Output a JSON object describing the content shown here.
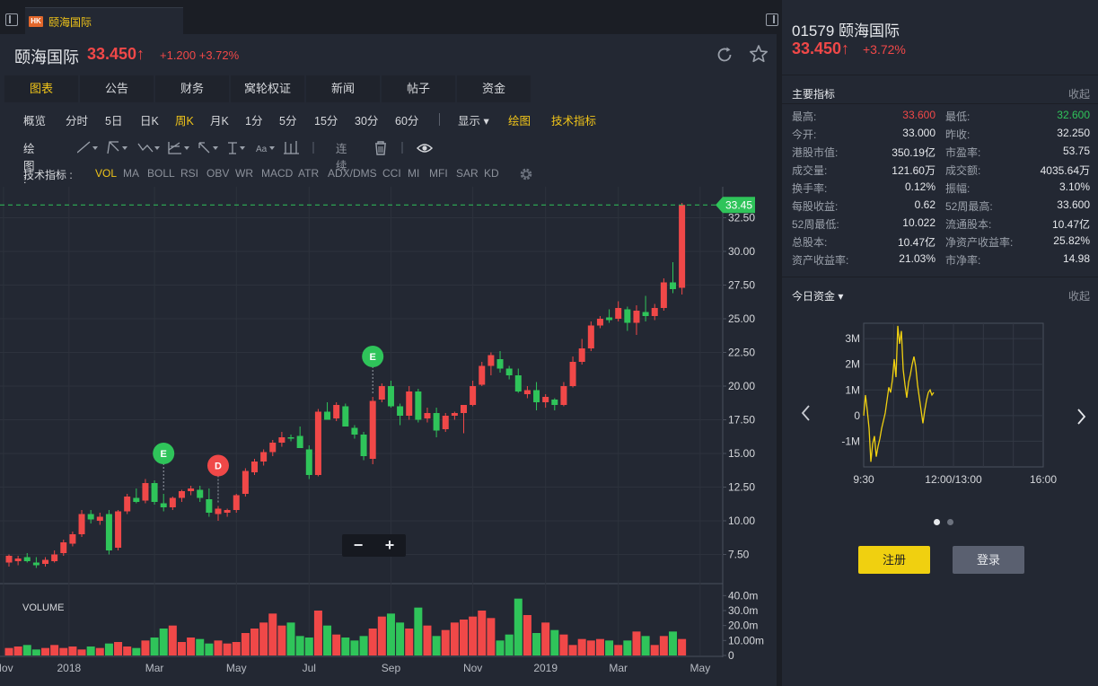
{
  "tab": {
    "market": "HK",
    "label": "颐海国际"
  },
  "header": {
    "name": "颐海国际",
    "price": "33.450↑",
    "change": "+1.200 +3.72%"
  },
  "main_tabs": [
    "图表",
    "公告",
    "财务",
    "窝轮权证",
    "新闻",
    "帖子",
    "资金"
  ],
  "timeframes": [
    "概览",
    "分时",
    "5日",
    "日K",
    "周K",
    "月K",
    "1分",
    "5分",
    "15分",
    "30分",
    "60分"
  ],
  "active_timeframe": "周K",
  "chart_options": {
    "display": "显示",
    "draw": "绘图",
    "indicators": "技术指标"
  },
  "draw_toolbar": {
    "label": "绘图 :",
    "continuous": "连续"
  },
  "indicator_bar": {
    "label": "技术指标 :",
    "items": [
      "VOL",
      "MA",
      "BOLL",
      "RSI",
      "OBV",
      "WR",
      "MACD",
      "ATR",
      "ADX/DMS",
      "CCI",
      "MI",
      "MFI",
      "SAR",
      "KD"
    ],
    "active": "VOL"
  },
  "chart_data": {
    "type": "candlestick",
    "price_axis_ticks": [
      "32.50",
      "30.00",
      "27.50",
      "25.00",
      "22.50",
      "20.00",
      "17.50",
      "15.00",
      "12.50",
      "10.00",
      "7.50"
    ],
    "price_range": [
      5.4,
      34.4
    ],
    "last_price_tag": "33.45",
    "last_price": 33.45,
    "x_axis_labels": [
      "Nov",
      "2018",
      "Mar",
      "May",
      "Jul",
      "Sep",
      "Nov",
      "2019",
      "Mar",
      "May"
    ],
    "volume_label": "VOLUME",
    "volume_axis_ticks": [
      "40.0m",
      "30.0m",
      "20.0m",
      "10.00m",
      "0"
    ],
    "volume_range_m": [
      0,
      48
    ],
    "colors": {
      "up": "#f04848",
      "down": "#2fc45a"
    },
    "candles": [
      {
        "o": 6.9,
        "h": 7.5,
        "l": 6.6,
        "c": 7.4
      },
      {
        "o": 7.0,
        "h": 7.4,
        "l": 6.7,
        "c": 7.2
      },
      {
        "o": 7.3,
        "h": 7.6,
        "l": 6.9,
        "c": 7.0
      },
      {
        "o": 6.9,
        "h": 7.3,
        "l": 6.5,
        "c": 6.7
      },
      {
        "o": 6.8,
        "h": 7.3,
        "l": 6.6,
        "c": 7.1
      },
      {
        "o": 7.0,
        "h": 7.8,
        "l": 6.9,
        "c": 7.5
      },
      {
        "o": 7.6,
        "h": 8.6,
        "l": 7.4,
        "c": 8.4
      },
      {
        "o": 8.3,
        "h": 9.2,
        "l": 8.1,
        "c": 9.0
      },
      {
        "o": 9.0,
        "h": 10.8,
        "l": 8.8,
        "c": 10.5
      },
      {
        "o": 10.5,
        "h": 10.8,
        "l": 9.8,
        "c": 10.1
      },
      {
        "o": 10.0,
        "h": 10.6,
        "l": 9.7,
        "c": 10.3
      },
      {
        "o": 10.5,
        "h": 10.8,
        "l": 7.5,
        "c": 7.8
      },
      {
        "o": 8.0,
        "h": 10.8,
        "l": 7.8,
        "c": 10.7
      },
      {
        "o": 10.7,
        "h": 12.0,
        "l": 10.5,
        "c": 11.8
      },
      {
        "o": 11.7,
        "h": 12.4,
        "l": 11.3,
        "c": 11.4
      },
      {
        "o": 11.5,
        "h": 13.1,
        "l": 11.3,
        "c": 12.8
      },
      {
        "o": 12.8,
        "h": 13.0,
        "l": 11.2,
        "c": 11.4
      },
      {
        "o": 11.3,
        "h": 12.0,
        "l": 10.7,
        "c": 11.0
      },
      {
        "o": 11.0,
        "h": 11.8,
        "l": 10.8,
        "c": 11.7
      },
      {
        "o": 11.7,
        "h": 12.3,
        "l": 11.4,
        "c": 12.2
      },
      {
        "o": 12.2,
        "h": 12.6,
        "l": 11.9,
        "c": 12.4
      },
      {
        "o": 12.3,
        "h": 12.6,
        "l": 11.4,
        "c": 11.7
      },
      {
        "o": 11.6,
        "h": 12.4,
        "l": 10.3,
        "c": 10.6
      },
      {
        "o": 10.5,
        "h": 11.1,
        "l": 10.0,
        "c": 10.9
      },
      {
        "o": 10.6,
        "h": 10.9,
        "l": 10.3,
        "c": 10.8
      },
      {
        "o": 10.8,
        "h": 12.0,
        "l": 10.6,
        "c": 11.9
      },
      {
        "o": 12.0,
        "h": 13.9,
        "l": 11.8,
        "c": 13.7
      },
      {
        "o": 13.6,
        "h": 14.6,
        "l": 13.4,
        "c": 14.4
      },
      {
        "o": 14.4,
        "h": 15.3,
        "l": 14.1,
        "c": 15.1
      },
      {
        "o": 15.1,
        "h": 16.0,
        "l": 14.8,
        "c": 15.8
      },
      {
        "o": 15.8,
        "h": 16.6,
        "l": 15.5,
        "c": 16.2
      },
      {
        "o": 16.2,
        "h": 16.4,
        "l": 15.9,
        "c": 16.1
      },
      {
        "o": 16.3,
        "h": 17.0,
        "l": 15.9,
        "c": 15.4
      },
      {
        "o": 15.3,
        "h": 15.6,
        "l": 13.1,
        "c": 13.4
      },
      {
        "o": 13.4,
        "h": 18.3,
        "l": 13.3,
        "c": 18.1
      },
      {
        "o": 18.1,
        "h": 18.8,
        "l": 17.6,
        "c": 17.5
      },
      {
        "o": 17.6,
        "h": 18.8,
        "l": 17.4,
        "c": 18.6
      },
      {
        "o": 18.5,
        "h": 18.7,
        "l": 17.2,
        "c": 17.0
      },
      {
        "o": 16.9,
        "h": 17.1,
        "l": 16.1,
        "c": 16.4
      },
      {
        "o": 16.4,
        "h": 16.6,
        "l": 14.5,
        "c": 14.8
      },
      {
        "o": 14.6,
        "h": 19.2,
        "l": 14.2,
        "c": 18.9
      },
      {
        "o": 19.0,
        "h": 20.2,
        "l": 18.8,
        "c": 20.0
      },
      {
        "o": 20.0,
        "h": 20.4,
        "l": 18.4,
        "c": 18.5
      },
      {
        "o": 18.5,
        "h": 18.7,
        "l": 17.1,
        "c": 17.8
      },
      {
        "o": 17.8,
        "h": 20.0,
        "l": 17.5,
        "c": 19.6
      },
      {
        "o": 19.6,
        "h": 19.8,
        "l": 17.3,
        "c": 17.5
      },
      {
        "o": 17.6,
        "h": 18.4,
        "l": 17.3,
        "c": 18.0
      },
      {
        "o": 18.0,
        "h": 18.4,
        "l": 16.2,
        "c": 16.7
      },
      {
        "o": 16.8,
        "h": 18.0,
        "l": 16.6,
        "c": 17.8
      },
      {
        "o": 17.8,
        "h": 18.1,
        "l": 17.5,
        "c": 18.0
      },
      {
        "o": 18.0,
        "h": 18.6,
        "l": 16.5,
        "c": 18.6
      },
      {
        "o": 18.6,
        "h": 20.4,
        "l": 18.5,
        "c": 20.0
      },
      {
        "o": 20.1,
        "h": 21.8,
        "l": 20.0,
        "c": 21.5
      },
      {
        "o": 21.5,
        "h": 22.5,
        "l": 20.8,
        "c": 22.3
      },
      {
        "o": 22.0,
        "h": 22.6,
        "l": 21.0,
        "c": 21.3
      },
      {
        "o": 21.3,
        "h": 21.5,
        "l": 20.5,
        "c": 20.8
      },
      {
        "o": 20.8,
        "h": 21.3,
        "l": 19.5,
        "c": 19.6
      },
      {
        "o": 19.4,
        "h": 20.0,
        "l": 19.1,
        "c": 19.7
      },
      {
        "o": 19.7,
        "h": 20.3,
        "l": 18.2,
        "c": 18.8
      },
      {
        "o": 18.8,
        "h": 19.4,
        "l": 18.4,
        "c": 19.2
      },
      {
        "o": 19.0,
        "h": 19.1,
        "l": 18.2,
        "c": 18.6
      },
      {
        "o": 18.6,
        "h": 20.3,
        "l": 18.5,
        "c": 20.0
      },
      {
        "o": 20.0,
        "h": 22.2,
        "l": 19.9,
        "c": 21.8
      },
      {
        "o": 21.8,
        "h": 23.5,
        "l": 21.6,
        "c": 22.8
      },
      {
        "o": 22.8,
        "h": 24.8,
        "l": 22.6,
        "c": 24.5
      },
      {
        "o": 24.5,
        "h": 25.2,
        "l": 24.3,
        "c": 25.0
      },
      {
        "o": 25.1,
        "h": 25.7,
        "l": 24.7,
        "c": 24.9
      },
      {
        "o": 25.0,
        "h": 26.3,
        "l": 24.8,
        "c": 25.8
      },
      {
        "o": 25.7,
        "h": 25.9,
        "l": 24.1,
        "c": 24.7
      },
      {
        "o": 24.7,
        "h": 26.0,
        "l": 23.8,
        "c": 25.6
      },
      {
        "o": 25.5,
        "h": 26.7,
        "l": 24.8,
        "c": 25.2
      },
      {
        "o": 25.2,
        "h": 26.1,
        "l": 24.9,
        "c": 25.8
      },
      {
        "o": 25.8,
        "h": 28.0,
        "l": 25.6,
        "c": 27.7
      },
      {
        "o": 27.7,
        "h": 29.2,
        "l": 26.9,
        "c": 27.2
      },
      {
        "o": 27.3,
        "h": 33.6,
        "l": 26.8,
        "c": 33.45
      }
    ],
    "volumes_m": [
      5,
      6,
      7,
      4,
      5,
      7,
      5,
      6,
      4,
      6,
      5,
      8,
      9,
      6,
      5,
      10,
      12,
      18,
      20,
      9,
      12,
      11,
      8,
      10,
      8,
      9,
      15,
      18,
      22,
      28,
      20,
      22,
      13,
      12,
      30,
      20,
      14,
      12,
      10,
      13,
      18,
      26,
      28,
      22,
      18,
      32,
      20,
      13,
      17,
      22,
      24,
      26,
      30,
      25,
      10,
      14,
      38,
      27,
      15,
      22,
      17,
      14,
      7,
      11,
      10,
      11,
      10,
      7,
      10,
      16,
      13,
      7,
      13,
      16,
      11,
      7,
      8,
      9
    ],
    "event_markers": [
      {
        "label": "E",
        "candle": 17,
        "kind": "earnings"
      },
      {
        "label": "D",
        "candle": 23,
        "kind": "dividend"
      },
      {
        "label": "E",
        "candle": 40,
        "kind": "earnings"
      }
    ],
    "grid": true
  },
  "zoom": {
    "minus": "−",
    "plus": "+"
  },
  "side": {
    "code_name": "01579 颐海国际",
    "price": "33.450↑",
    "change": "+3.72%",
    "metrics_title": "主要指标",
    "collapse": "收起",
    "metrics": [
      [
        "最高:",
        "33.600",
        "最低:",
        "32.600"
      ],
      [
        "今开:",
        "33.000",
        "昨收:",
        "32.250"
      ],
      [
        "港股市值:",
        "350.19亿",
        "市盈率:",
        "53.75"
      ],
      [
        "成交量:",
        "121.60万",
        "成交额:",
        "4035.64万"
      ],
      [
        "换手率:",
        "0.12%",
        "振幅:",
        "3.10%"
      ],
      [
        "每股收益:",
        "0.62",
        "52周最高:",
        "33.600"
      ],
      [
        "52周最低:",
        "10.022",
        "流通股本:",
        "10.47亿"
      ],
      [
        "总股本:",
        "10.47亿",
        "净资产收益率:",
        "25.82%"
      ],
      [
        "资产收益率:",
        "21.03%",
        "市净率:",
        "14.98"
      ]
    ],
    "metric_colors": {
      "high": "#f04848",
      "low": "#2fc45a"
    },
    "funds_title": "今日资金",
    "funds_collapse": "收起",
    "funds_chart": {
      "y_ticks": [
        "3M",
        "2M",
        "1M",
        "0",
        "-1M"
      ],
      "x_ticks": [
        "9:30",
        "12:00/13:00",
        "16:00"
      ],
      "y_range_m": [
        -2,
        3.6
      ],
      "values_m": [
        0,
        0.8,
        0.2,
        -0.5,
        -1.8,
        -1.1,
        -0.8,
        -1.6,
        -1.2,
        -0.9,
        -0.5,
        -0.2,
        0.1,
        0.6,
        1.1,
        0.9,
        1.4,
        2.2,
        1.5,
        3.5,
        2.8,
        3.3,
        1.8,
        1.2,
        0.7,
        1.3,
        1.6,
        2.0,
        2.3,
        1.9,
        1.2,
        0.7,
        0.2,
        -0.3,
        0.2,
        0.6,
        0.9,
        1.0,
        0.8,
        0.9
      ],
      "line_color": "#f0d010"
    },
    "register": "注册",
    "login": "登录"
  }
}
